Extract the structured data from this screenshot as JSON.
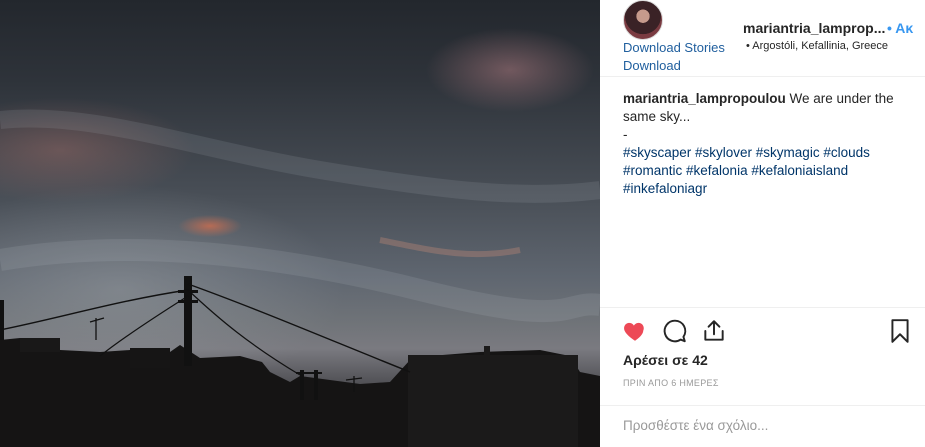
{
  "post": {
    "username_short": "mariantria_lamprop...",
    "follow_label": "• Ακ",
    "location": "• Argostóli, Kefallinia, Greece",
    "download_stories": "Download Stories",
    "download": "Download"
  },
  "caption": {
    "user": "mariantria_lampropoulou",
    "text": " We are under the same sky...",
    "dash": "-",
    "hashtags": "#skyscaper #skylover #skymagic #clouds #romantic #kefalonia #kefaloniaisland #inkefaloniagr"
  },
  "actions": {
    "likes": "Αρέσει σε 42",
    "time": "ΠΡΙΝ ΑΠΟ 6 ΗΜΕΡΕΣ",
    "comment_placeholder": "Προσθέστε ένα σχόλιο...",
    "icons": [
      "heart-icon",
      "comment-icon",
      "share-icon",
      "bookmark-icon"
    ],
    "liked_color": "#ed4956"
  },
  "colors": {
    "link": "#205f9e",
    "hashtag": "#003569",
    "follow": "#3897f0"
  }
}
